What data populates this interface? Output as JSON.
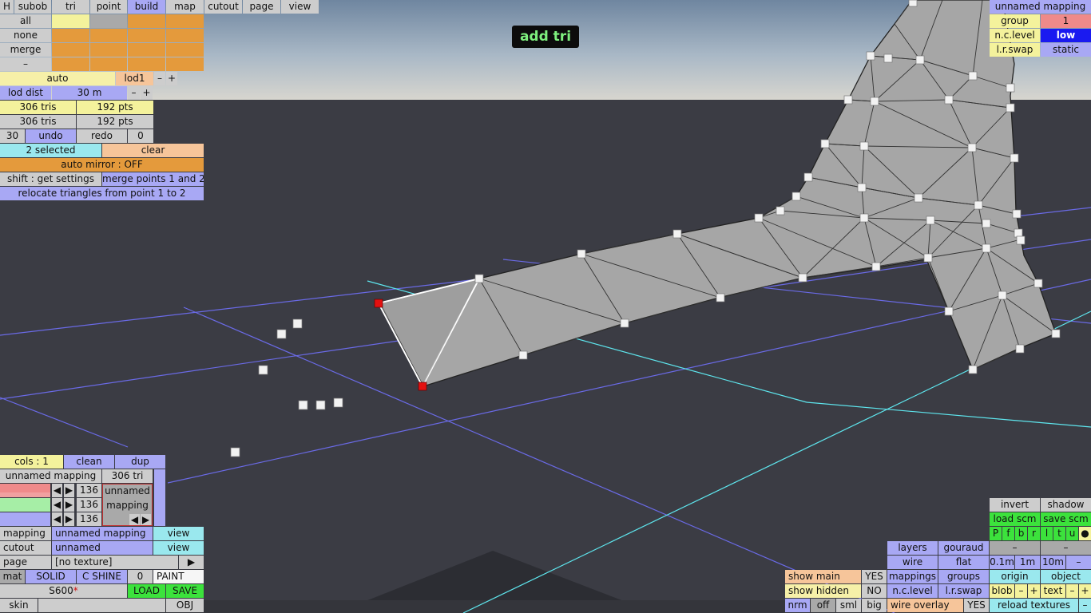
{
  "hud": {
    "status": "add tri"
  },
  "top_tabs": [
    "H",
    "subob",
    "tri",
    "point",
    "build",
    "map",
    "cutout",
    "page",
    "view"
  ],
  "select": {
    "all": "all",
    "none": "none",
    "merge": "merge",
    "minus": "–"
  },
  "lod": {
    "auto": "auto",
    "lod1": "lod1",
    "minus": "–",
    "plus": "+",
    "dist_label": "lod dist",
    "dist_value": "30 m"
  },
  "stats": {
    "tris1": "306 tris",
    "pts1": "192 pts",
    "tris2": "306 tris",
    "pts2": "192 pts"
  },
  "history": {
    "count_left": "30",
    "undo": "undo",
    "redo": "redo",
    "count_right": "0"
  },
  "selection": {
    "selected": "2 selected",
    "clear": "clear",
    "auto_mirror": "auto mirror : OFF",
    "shift": "shift : get settings",
    "merge_points": "merge points 1 and 2",
    "relocate": "relocate triangles from point 1 to 2"
  },
  "top_right": {
    "mapping_name": "unnamed mapping",
    "group_label": "group",
    "group_value": "1",
    "nc_label": "n.c.level",
    "nc_value": "low",
    "lr_label": "l.r.swap",
    "lr_value": "static"
  },
  "colors": {
    "cols": "cols : 1",
    "clean": "clean",
    "dup": "dup",
    "mapping_name": "unnamed mapping",
    "tri_count": "306 tri",
    "rgb": [
      "136",
      "136",
      "136"
    ],
    "preview_label_1": "unnamed",
    "preview_label_2": "mapping",
    "arrow_left": "◀",
    "arrow_right": "▶"
  },
  "material_rows": {
    "mapping_label": "mapping",
    "mapping_value": "unnamed mapping",
    "mapping_view": "view",
    "cutout_label": "cutout",
    "cutout_value": "unnamed",
    "cutout_view": "view",
    "page_label": "page",
    "page_value": "[no texture]",
    "page_arrow": "▶",
    "mat": "mat",
    "solid": "SOLID",
    "shine": "C SHINE",
    "shine_value": "0",
    "paint": "PAINT",
    "skin_code": "S600",
    "skin_mark": "*",
    "load": "LOAD",
    "save": "SAVE",
    "skin": "skin",
    "obj": "OBJ"
  },
  "bottom_right": {
    "invert": "invert",
    "shadow": "shadow",
    "load_scm": "load scm",
    "save_scm": "save scm",
    "flags": [
      "P",
      "f",
      "b",
      "r",
      "l",
      "t",
      "u",
      "●"
    ],
    "layers": "layers",
    "gouraud": "gouraud",
    "dash1": "–",
    "dash2": "–",
    "wire": "wire",
    "flat": "flat",
    "m01": "0.1m",
    "m1": "1m",
    "m10": "10m",
    "mminus": "–",
    "show_main": "show main",
    "show_main_val": "YES",
    "mappings": "mappings",
    "groups": "groups",
    "origin": "origin",
    "object": "object",
    "show_hidden": "show hidden",
    "show_hidden_val": "NO",
    "nc_level": "n.c.level",
    "lr_swap": "l.r.swap",
    "blob": "blob",
    "blob_minus": "–",
    "blob_plus": "+",
    "text": "text",
    "text_minus": "–",
    "text_plus": "+",
    "nrm": "nrm",
    "off": "off",
    "sml": "sml",
    "big": "big",
    "wire_overlay": "wire overlay",
    "wire_overlay_val": "YES",
    "reload_textures": "reload textures",
    "reload_minus": "–"
  },
  "theme": {
    "sky_top": "#6f86a0",
    "ground": "#3b3c44",
    "mesh_fill": "#a6a6a6",
    "grid_blue": "#6a6ae6",
    "grid_cyan": "#5ee6ee",
    "selected_point": "#e31010"
  }
}
